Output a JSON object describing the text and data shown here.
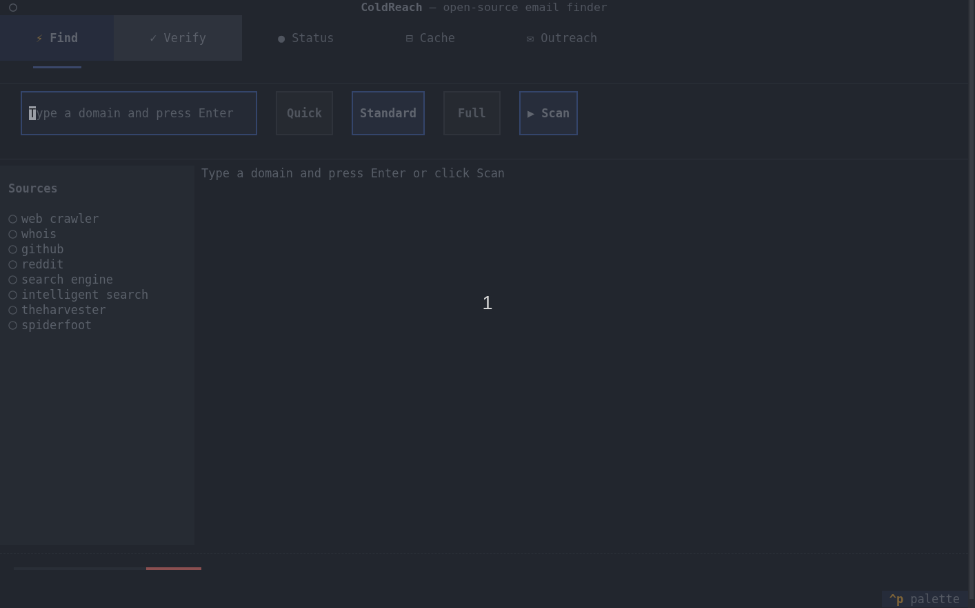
{
  "window": {
    "title": "**ColdReach** — open-source email finder"
  },
  "tabs": [
    {
      "glyph": "⚡",
      "label": "Find",
      "selected": true,
      "hovered": false
    },
    {
      "glyph": "✓",
      "label": "Verify",
      "selected": false,
      "hovered": true
    },
    {
      "glyph": "●",
      "label": "Status",
      "selected": false,
      "hovered": false
    },
    {
      "glyph": "⊟",
      "label": "Cache",
      "selected": false,
      "hovered": false
    },
    {
      "glyph": "✉",
      "label": "Outreach",
      "selected": false,
      "hovered": false
    }
  ],
  "search": {
    "placeholder": "Type a domain and press Enter",
    "focused": true
  },
  "modes": [
    {
      "label": "Quick",
      "selected": false
    },
    {
      "label": "Standard",
      "selected": true
    },
    {
      "label": "Full",
      "selected": false
    }
  ],
  "scan_button": {
    "label": "▶ Scan"
  },
  "sidebar": {
    "title": "Sources",
    "items": [
      {
        "label": "web crawler",
        "done": false
      },
      {
        "label": "whois",
        "done": false
      },
      {
        "label": "github",
        "done": false
      },
      {
        "label": "reddit",
        "done": false
      },
      {
        "label": "search engine",
        "done": false
      },
      {
        "label": "intelligent search",
        "done": false
      },
      {
        "label": "theharvester",
        "done": false
      },
      {
        "label": "spiderfoot",
        "done": false
      }
    ]
  },
  "main": {
    "message": "Type a domain and press Enter or click Scan"
  },
  "overlay_number": "1",
  "progress_bar": {
    "kind": "indeterminate"
  },
  "footer": {
    "key": "^p",
    "label": "palette"
  }
}
